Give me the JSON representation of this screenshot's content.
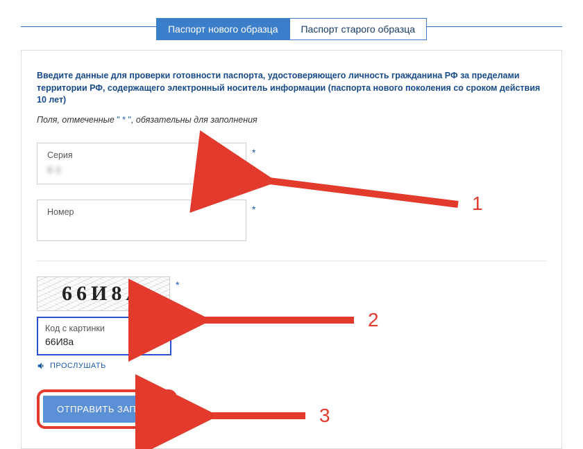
{
  "tabs": {
    "active": "Паспорт нового образца",
    "other": "Паспорт старого образца"
  },
  "intro": "Введите данные для проверки готовности паспорта, удостоверяющего личность гражданина РФ за пределами территории РФ, содержащего электронный носитель информации (паспорта нового поколения со сроком действия 10 лет)",
  "hint_prefix": "Поля, отмеченные ",
  "hint_ast": "\" * \"",
  "hint_suffix": ", обязательны для заполнения",
  "fields": {
    "series": {
      "label": "Серия",
      "value": "8      3",
      "req": "*"
    },
    "number": {
      "label": "Номер",
      "value": "        ",
      "req": "*"
    }
  },
  "captcha": {
    "text": "66И8А",
    "req": "*",
    "input_label": "Код с картинки",
    "input_value": "66И8а",
    "listen": "ПРОСЛУШАТЬ"
  },
  "submit": "ОТПРАВИТЬ ЗАПРОС",
  "annot": {
    "n1": "1",
    "n2": "2",
    "n3": "3"
  }
}
